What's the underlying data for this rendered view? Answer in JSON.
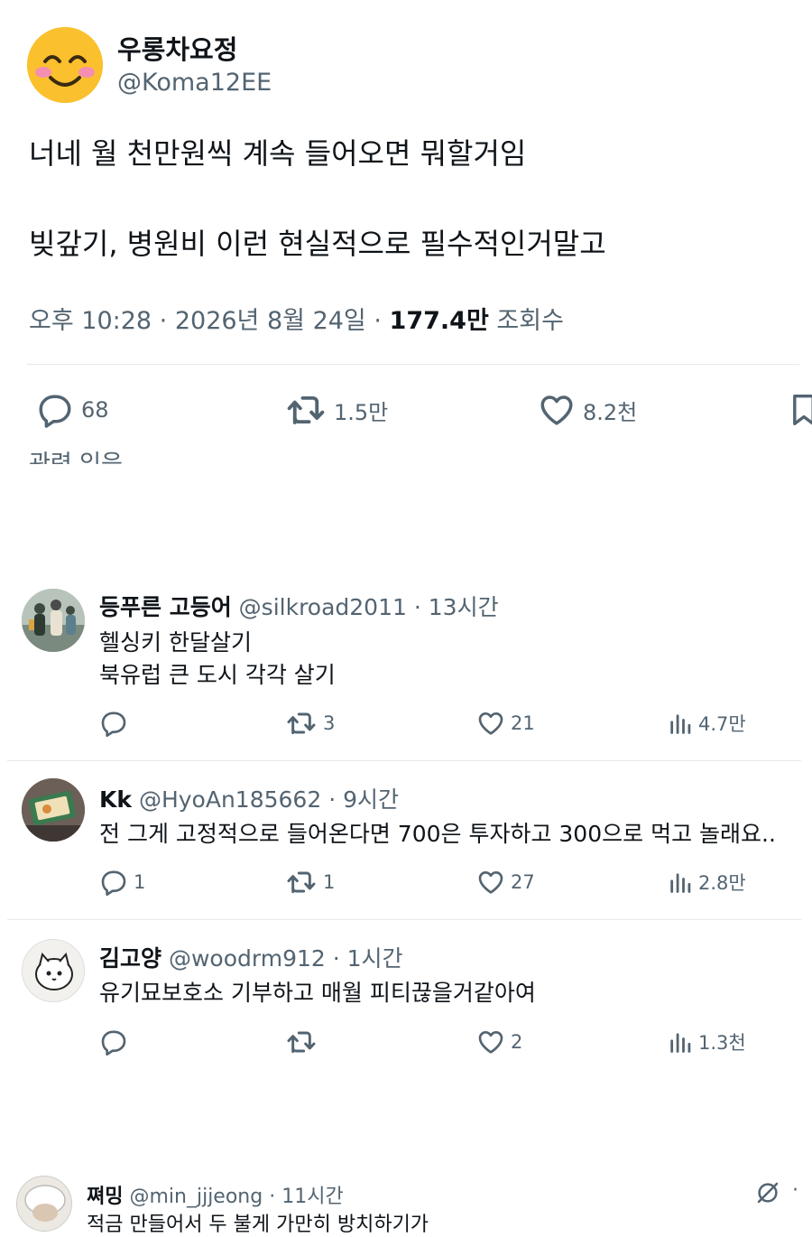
{
  "main_tweet": {
    "display_name": "우롱차요정",
    "handle": "@Koma12EE",
    "text_line1": "너네 월 천만원씩 계속 들어오면 뭐할거임",
    "text_line2": "빚갚기, 병원비 이런 현실적으로 필수적인거말고",
    "time": "오후 10:28",
    "date": "2026년 8월 24일",
    "views_count": "177.4만",
    "views_label": "조회수",
    "replies": "68",
    "retweets": "1.5만",
    "likes": "8.2천",
    "cut_off_text": "관련 있음"
  },
  "replies": [
    {
      "name": "등푸른 고등어",
      "handle": "@silkroad2011",
      "time": "13시간",
      "lines": [
        "헬싱키 한달살기",
        "북유럽 큰 도시 각각 살기"
      ],
      "reply_count": "",
      "retweet_count": "3",
      "like_count": "21",
      "view_count": "4.7만"
    },
    {
      "name": "Kk",
      "handle": "@HyoAn185662",
      "time": "9시간",
      "lines": [
        "전 그게 고정적으로 들어온다면 700은 투자하고 300으로 먹고 놀래요.."
      ],
      "reply_count": "1",
      "retweet_count": "1",
      "like_count": "27",
      "view_count": "2.8만"
    },
    {
      "name": "김고양",
      "handle": "@woodrm912",
      "time": "1시간",
      "lines": [
        "유기묘보호소 기부하고 매월 피티끊을거같아여"
      ],
      "reply_count": "",
      "retweet_count": "",
      "like_count": "2",
      "view_count": "1.3천"
    },
    {
      "name": "쪄밍",
      "handle": "@min_jjjeong",
      "time": "11시간",
      "lines": [
        "적금 만들어서 두 불게 가만히 방치하기가"
      ],
      "reply_count": "",
      "retweet_count": "",
      "like_count": "",
      "view_count": ""
    }
  ],
  "colors": {
    "text": "#0f1419",
    "secondary": "#536471",
    "divider": "#e6e9ec",
    "avatar_yellow": "#fbc531"
  }
}
